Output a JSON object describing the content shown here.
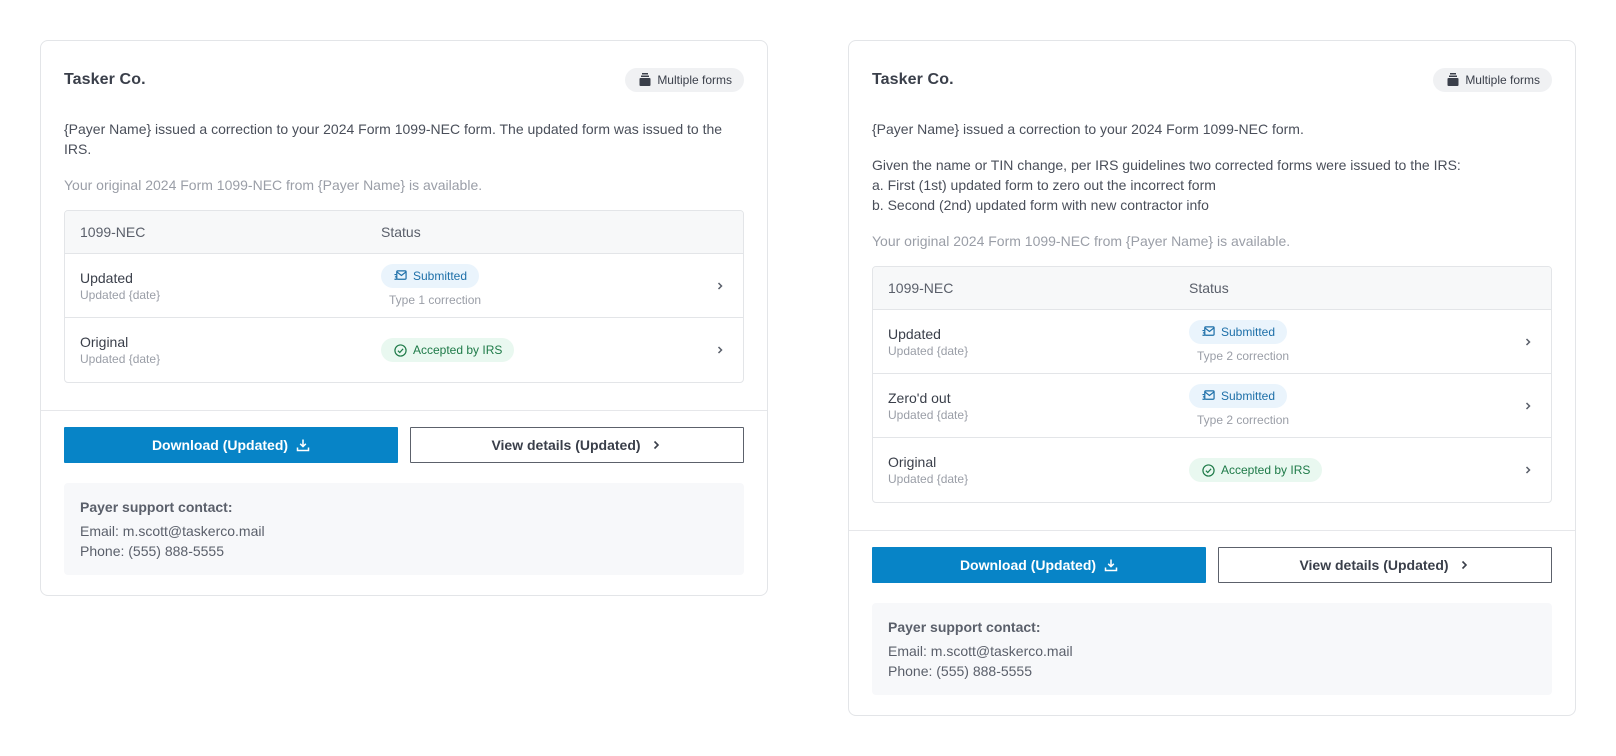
{
  "colors": {
    "primary": "#0784c7",
    "submitted_bg": "#eaf4fc",
    "submitted_fg": "#1d6fa8",
    "accepted_bg": "#e9f8f0",
    "accepted_fg": "#1e7a48"
  },
  "cards": [
    {
      "payer_name": "Tasker Co.",
      "chip": {
        "icon": "stack-icon",
        "label": "Multiple forms"
      },
      "message": "{Payer Name} issued a correction to your 2024 Form 1099-NEC  form. The updated form was issued to the IRS.",
      "available_note": "Your original 2024 Form 1099-NEC from {Payer Name} is available.",
      "table": {
        "headers": [
          "1099-NEC",
          "Status"
        ],
        "rows": [
          {
            "title": "Updated",
            "subtitle": "Updated {date}",
            "status": "Submitted",
            "status_type": "submitted",
            "status_icon": "mail-send-icon",
            "note": "Type 1 correction"
          },
          {
            "title": "Original",
            "subtitle": "Updated {date}",
            "status": "Accepted by IRS",
            "status_type": "accepted",
            "status_icon": "check-circle-icon",
            "note": ""
          }
        ]
      },
      "buttons": {
        "download": "Download (Updated)",
        "view": "View details (Updated)"
      },
      "support": {
        "title": "Payer support contact:",
        "email": "Email: m.scott@taskerco.mail",
        "phone": "Phone: (555) 888-5555"
      }
    },
    {
      "payer_name": "Tasker Co.",
      "chip": {
        "icon": "stack-icon",
        "label": "Multiple forms"
      },
      "message": "{Payer Name} issued a correction to your 2024 Form 1099-NEC  form.",
      "explanation": [
        "Given the name or TIN change, per IRS guidelines two corrected forms were issued to the IRS:",
        "a. First (1st) updated form to zero out the incorrect form",
        "b. Second (2nd) updated form with new contractor info"
      ],
      "available_note": "Your original 2024 Form 1099-NEC from {Payer Name} is available.",
      "table": {
        "headers": [
          "1099-NEC",
          "Status"
        ],
        "rows": [
          {
            "title": "Updated",
            "subtitle": "Updated {date}",
            "status": "Submitted",
            "status_type": "submitted",
            "status_icon": "mail-send-icon",
            "note": "Type 2 correction"
          },
          {
            "title": "Zero'd out",
            "subtitle": "Updated {date}",
            "status": "Submitted",
            "status_type": "submitted",
            "status_icon": "mail-send-icon",
            "note": "Type 2 correction"
          },
          {
            "title": "Original",
            "subtitle": "Updated {date}",
            "status": "Accepted by IRS",
            "status_type": "accepted",
            "status_icon": "check-circle-icon",
            "note": ""
          }
        ]
      },
      "buttons": {
        "download": "Download (Updated)",
        "view": "View details (Updated)"
      },
      "support": {
        "title": "Payer support contact:",
        "email": "Email: m.scott@taskerco.mail",
        "phone": "Phone: (555) 888-5555"
      }
    }
  ]
}
